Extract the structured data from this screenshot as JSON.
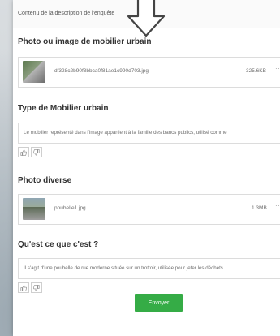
{
  "header": {
    "description_label": "Contenu de la description de l'enquête"
  },
  "section_photo_mobilier": {
    "title": "Photo ou image de mobilier urbain",
    "file": {
      "name": "df328c2b90f3bbca0f81ae1c990d703.jpg",
      "size": "325.6KB",
      "more": "···"
    }
  },
  "section_type": {
    "title": "Type de Mobilier urbain",
    "answer": "Le mobilier représenté dans l'image appartient à la famille des bancs publics, utilisé comme"
  },
  "section_photo_diverse": {
    "title": "Photo diverse",
    "file": {
      "name": "poubelle1.jpg",
      "size": "1.3MB",
      "more": "···"
    }
  },
  "section_quest": {
    "title": "Qu'est ce que c'est ?",
    "answer": "Il s'agit d'une poubelle de rue moderne située sur un trottoir, utilisée pour jeter les déchets"
  },
  "submit": {
    "label": "Envoyer"
  },
  "colors": {
    "accent_green": "#35ac46"
  },
  "icons": {
    "arrow": "arrow-down-icon",
    "thumbs_up": "thumbs-up-icon",
    "thumbs_down": "thumbs-down-icon"
  }
}
